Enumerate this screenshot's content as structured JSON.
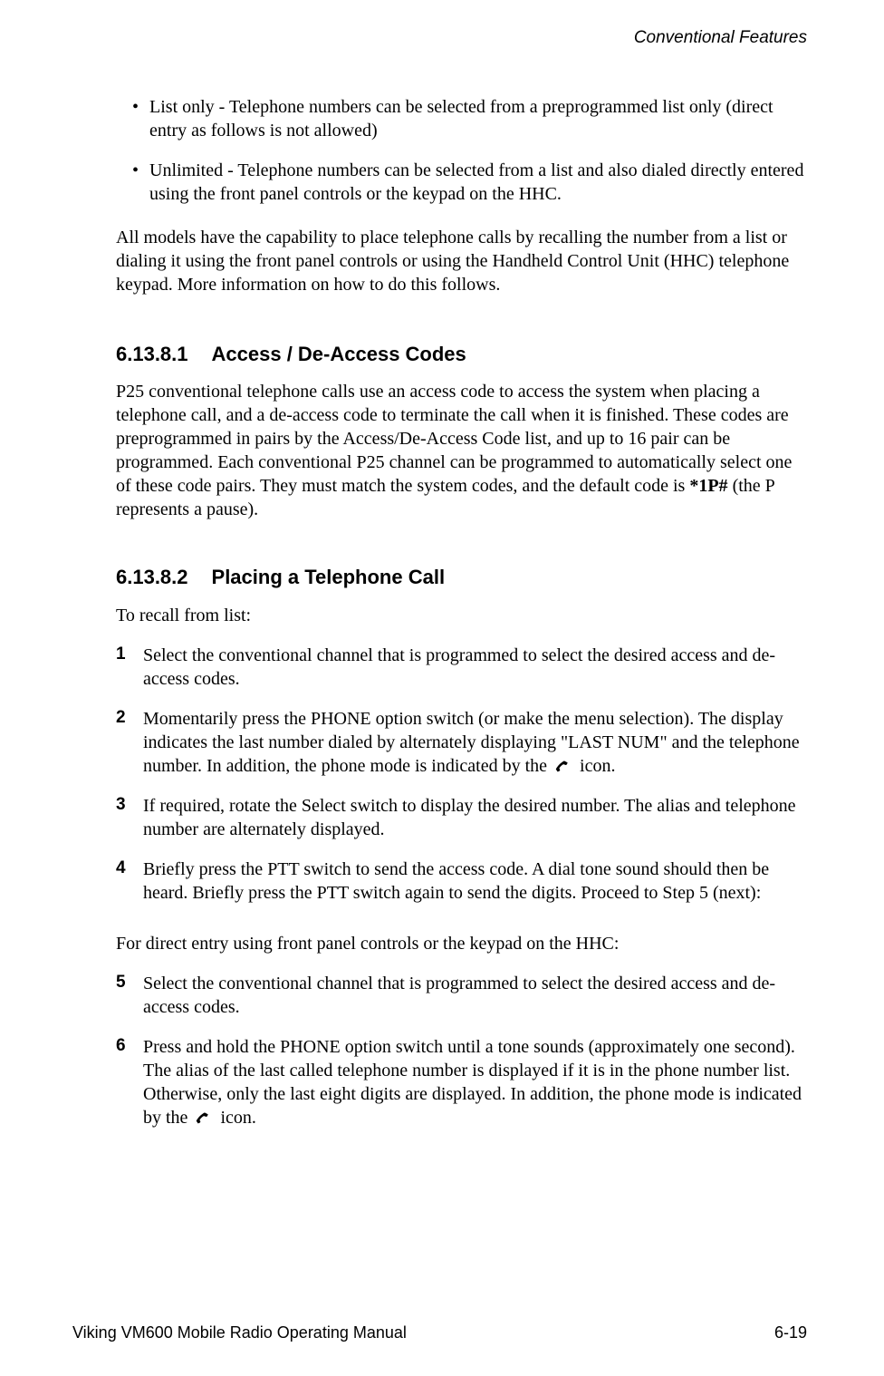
{
  "header": {
    "running_title": "Conventional Features"
  },
  "bullets": [
    "List only - Telephone numbers can be selected from a preprogrammed list only (direct entry as follows is not allowed)",
    "Unlimited - Telephone numbers can be selected from a list and also dialed directly entered using the front panel controls or the keypad on the HHC."
  ],
  "para1": "All models have the capability to place telephone calls by recalling the number from a list or dialing it using the front panel controls or using the Handheld Control Unit (HHC) telephone keypad. More information on how to do this follows.",
  "section1": {
    "number": "6.13.8.1",
    "title": "Access / De-Access Codes",
    "body_pre": "P25 conventional telephone calls use an access code to access the system when placing a telephone call, and a de-access code to terminate the call when it is finished. These codes are preprogrammed in pairs by the Access/De-Access Code list, and up to 16 pair can be programmed. Each conventional P25 channel can be programmed to automatically select one of these code pairs. They must match the system codes, and the default code is ",
    "code": "*1P#",
    "body_post": " (the P represents a pause)."
  },
  "section2": {
    "number": "6.13.8.2",
    "title": "Placing a Telephone Call",
    "intro": "To recall from list:",
    "steps_a": [
      {
        "n": "1",
        "text": "Select the conventional channel that is programmed to select the desired access and de-access codes."
      },
      {
        "n": "2",
        "text_pre": "Momentarily press the PHONE option switch (or make the menu selection). The display indicates the last number dialed by alternately displaying \"LAST NUM\" and the telephone number. In addition, the phone mode is indicated by the ",
        "text_post": " icon."
      },
      {
        "n": "3",
        "text": "If required, rotate the Select switch to display the desired number. The alias and telephone number are alternately displayed."
      },
      {
        "n": "4",
        "text": "Briefly press the PTT switch to send the access code. A dial tone sound should then be heard. Briefly press the PTT switch again to send the digits. Proceed to Step 5 (next):"
      }
    ],
    "mid": "For direct entry using front panel controls or the keypad on the HHC:",
    "steps_b": [
      {
        "n": "5",
        "text": "Select the conventional channel that is programmed to select the desired access and de-access codes."
      },
      {
        "n": "6",
        "text_pre": "Press and hold the PHONE option switch until a tone sounds (approximately one second). The alias of the last called telephone number is displayed if it is in the phone number list. Otherwise, only the last eight digits are displayed. In addition, the phone mode is indicated by the ",
        "text_post": " icon."
      }
    ]
  },
  "footer": {
    "left": "Viking VM600 Mobile Radio Operating Manual",
    "right": "6-19"
  },
  "icons": {
    "phone": "phone-handset-icon"
  }
}
